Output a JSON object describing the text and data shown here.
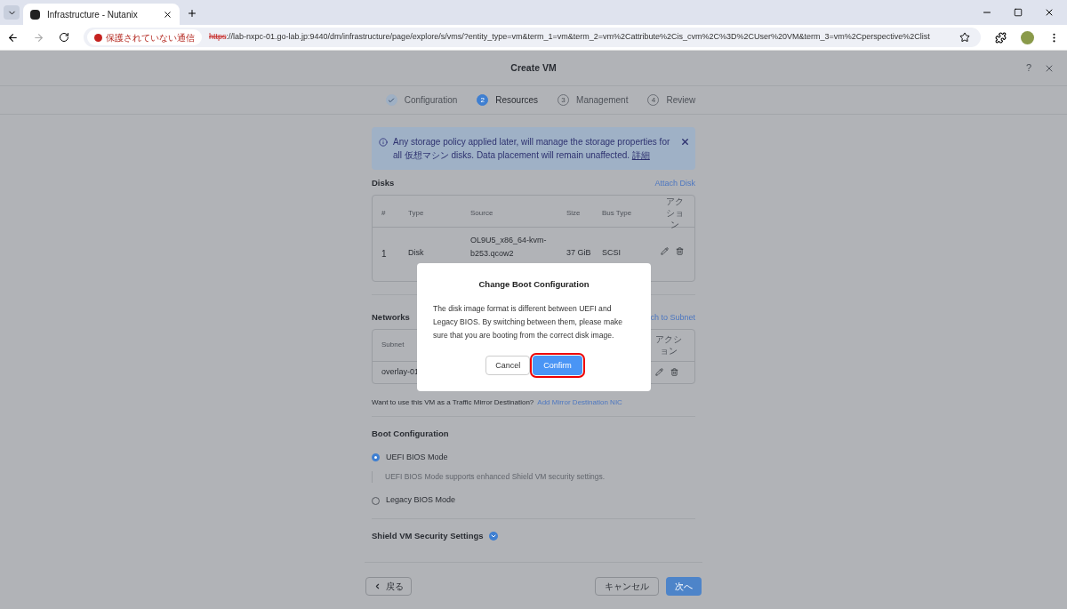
{
  "browser": {
    "tab_title": "Infrastructure - Nutanix",
    "security_label": "保護されていない通信",
    "url_scheme": "https",
    "url_rest": "://lab-nxpc-01.go-lab.jp:9440/dm/infrastructure/page/explore/s/vms/?entity_type=vm&term_1=vm&term_2=vm%2Cattribute%2Cis_cvm%2C%3D%2CUser%20VM&term_3=vm%2Cperspective%2Clist"
  },
  "window": {
    "title": "Create VM",
    "help": "?"
  },
  "steps": [
    {
      "label": "Configuration",
      "kind": "done"
    },
    {
      "number": "2",
      "label": "Resources",
      "kind": "current"
    },
    {
      "number": "3",
      "label": "Management",
      "kind": "pending"
    },
    {
      "number": "4",
      "label": "Review",
      "kind": "pending"
    }
  ],
  "banner": {
    "text": "Any storage policy applied later, will manage the storage properties for all 仮想マシン disks. Data placement will remain unaffected.",
    "link": "詳細"
  },
  "disks": {
    "title": "Disks",
    "action": "Attach Disk",
    "columns": [
      "#",
      "Type",
      "Source",
      "Size",
      "Bus Type",
      "アクション"
    ],
    "rows": [
      {
        "index": "1",
        "type": "Disk",
        "source": "OL9U5_x86_64-kvm-b253.qcow2",
        "size": "37 GiB",
        "bus": "SCSI"
      }
    ]
  },
  "networks": {
    "title": "Networks",
    "action": "ch to Subnet",
    "columns": [
      "Subnet",
      "アクション"
    ],
    "rows": [
      {
        "subnet": "overlay-01"
      }
    ]
  },
  "mirror": {
    "question": "Want to use this VM as a Traffic Mirror Destination?",
    "link": "Add Mirror Destination NIC"
  },
  "boot": {
    "title": "Boot Configuration",
    "options": [
      {
        "label": "UEFI BIOS Mode",
        "selected": true,
        "hint": "UEFI BIOS Mode supports enhanced Shield VM security settings."
      },
      {
        "label": "Legacy BIOS Mode",
        "selected": false
      }
    ]
  },
  "shield": {
    "title": "Shield VM Security Settings",
    "expanded": false
  },
  "footer": {
    "back": "戻る",
    "cancel": "キャンセル",
    "next": "次へ"
  },
  "dialog": {
    "title": "Change Boot Configuration",
    "body": "The disk image format is different between UEFI and Legacy BIOS. By switching between them, please make sure that you are booting from the correct disk image.",
    "cancel": "Cancel",
    "confirm": "Confirm",
    "confirm_highlighted": true
  }
}
